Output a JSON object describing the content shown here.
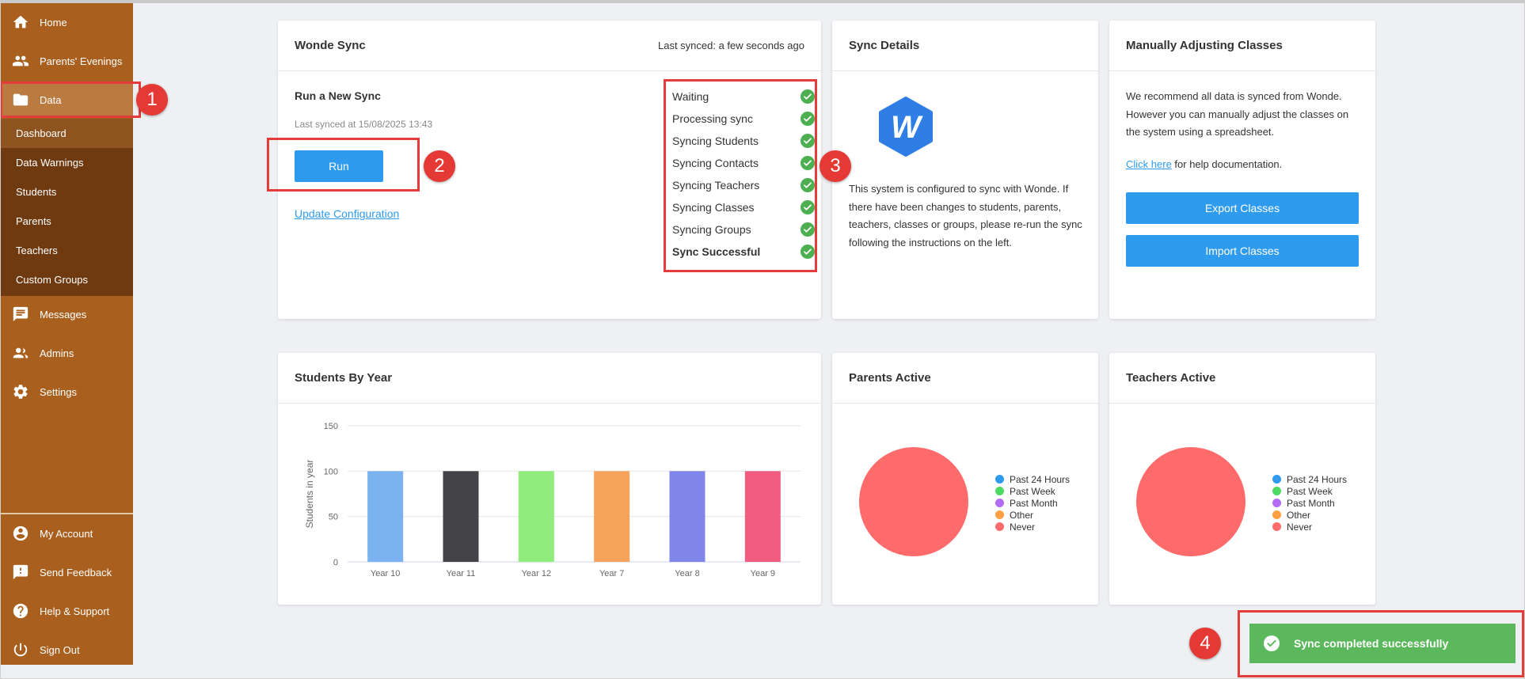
{
  "sidebar": {
    "items": [
      {
        "label": "Home",
        "icon": "home-icon"
      },
      {
        "label": "Parents' Evenings",
        "icon": "people-icon"
      },
      {
        "label": "Data",
        "icon": "folder-icon"
      },
      {
        "label": "Messages",
        "icon": "message-icon"
      },
      {
        "label": "Admins",
        "icon": "admins-icon"
      },
      {
        "label": "Settings",
        "icon": "gear-icon"
      }
    ],
    "subitems": [
      {
        "label": "Dashboard"
      },
      {
        "label": "Data Warnings"
      },
      {
        "label": "Students"
      },
      {
        "label": "Parents"
      },
      {
        "label": "Teachers"
      },
      {
        "label": "Custom Groups"
      }
    ],
    "bottom": [
      {
        "label": "My Account",
        "icon": "account-icon"
      },
      {
        "label": "Send Feedback",
        "icon": "feedback-icon"
      },
      {
        "label": "Help & Support",
        "icon": "help-icon"
      },
      {
        "label": "Sign Out",
        "icon": "power-icon"
      }
    ]
  },
  "wonde_sync": {
    "title": "Wonde Sync",
    "last_synced_header": "Last synced: a few seconds ago",
    "run_title": "Run a New Sync",
    "last_synced_at": "Last synced at 15/08/2025 13:43",
    "run_button": "Run",
    "update_config_link": "Update Configuration",
    "steps": [
      {
        "label": "Waiting",
        "bold": false
      },
      {
        "label": "Processing sync",
        "bold": false
      },
      {
        "label": "Syncing Students",
        "bold": false
      },
      {
        "label": "Syncing Contacts",
        "bold": false
      },
      {
        "label": "Syncing Teachers",
        "bold": false
      },
      {
        "label": "Syncing Classes",
        "bold": false
      },
      {
        "label": "Syncing Groups",
        "bold": false
      },
      {
        "label": "Sync Successful",
        "bold": true
      }
    ]
  },
  "sync_details": {
    "title": "Sync Details",
    "logo_letter": "W",
    "description": "This system is configured to sync with Wonde. If there have been changes to students, parents, teachers, classes or groups, please re-run the sync following the instructions on the left."
  },
  "manual_classes": {
    "title": "Manually Adjusting Classes",
    "description": "We recommend all data is synced from Wonde. However you can manually adjust the classes on the system using a spreadsheet.",
    "help_link": "Click here",
    "help_suffix": " for help documentation.",
    "export_button": "Export Classes",
    "import_button": "Import Classes"
  },
  "students_by_year": {
    "title": "Students By Year"
  },
  "parents_active": {
    "title": "Parents Active",
    "legend": [
      {
        "label": "Past 24 Hours",
        "color": "#2e9bef"
      },
      {
        "label": "Past Week",
        "color": "#4cd964"
      },
      {
        "label": "Past Month",
        "color": "#b36cf5"
      },
      {
        "label": "Other",
        "color": "#ff9f40"
      },
      {
        "label": "Never",
        "color": "#ff6b6b"
      }
    ]
  },
  "teachers_active": {
    "title": "Teachers Active",
    "legend": [
      {
        "label": "Past 24 Hours",
        "color": "#2e9bef"
      },
      {
        "label": "Past Week",
        "color": "#4cd964"
      },
      {
        "label": "Past Month",
        "color": "#b36cf5"
      },
      {
        "label": "Other",
        "color": "#ff9f40"
      },
      {
        "label": "Never",
        "color": "#ff6b6b"
      }
    ]
  },
  "toast": {
    "message": "Sync completed successfully"
  },
  "annotations": [
    "1",
    "2",
    "3",
    "4"
  ],
  "chart_data": [
    {
      "type": "bar",
      "title": "Students By Year",
      "ylabel": "Students in year",
      "xlabel": "",
      "categories": [
        "Year 10",
        "Year 11",
        "Year 12",
        "Year 7",
        "Year 8",
        "Year 9"
      ],
      "values": [
        100,
        100,
        100,
        100,
        100,
        100
      ],
      "colors": [
        "#7ab3ef",
        "#434348",
        "#90ed7d",
        "#f7a35c",
        "#8085e9",
        "#f15c80"
      ],
      "ylim": [
        0,
        150
      ],
      "yticks": [
        0,
        50,
        100,
        150
      ],
      "grid": true
    },
    {
      "type": "pie",
      "title": "Parents Active",
      "categories": [
        "Past 24 Hours",
        "Past Week",
        "Past Month",
        "Other",
        "Never"
      ],
      "values": [
        0,
        0,
        0,
        0,
        100
      ],
      "colors": [
        "#2e9bef",
        "#4cd964",
        "#b36cf5",
        "#ff9f40",
        "#ff6b6b"
      ],
      "legend": "right"
    },
    {
      "type": "pie",
      "title": "Teachers Active",
      "categories": [
        "Past 24 Hours",
        "Past Week",
        "Past Month",
        "Other",
        "Never"
      ],
      "values": [
        0,
        0,
        0,
        0,
        100
      ],
      "colors": [
        "#2e9bef",
        "#4cd964",
        "#b36cf5",
        "#ff9f40",
        "#ff6b6b"
      ],
      "legend": "right"
    }
  ]
}
